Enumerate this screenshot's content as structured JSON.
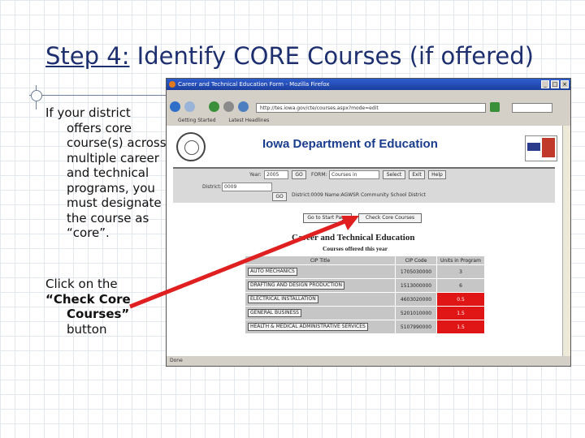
{
  "slide": {
    "title_prefix": "Step 4:",
    "title_rest": " Identify CORE Courses (if offered)",
    "para1": "If your district offers core course(s) across multiple career and technical programs, you must designate the course as “core”.",
    "para2_line1": "Click on the",
    "para2_bold": "“Check Core Courses”",
    "para2_line3": "button"
  },
  "browser": {
    "window_title": "Career and Technical Education Form - Mozilla Firefox",
    "url": "http://tes.iowa.gov/cte/courses.aspx?mode=edit",
    "bookmarks": [
      "Getting Started",
      "Latest Headlines"
    ],
    "status": "Done",
    "window_buttons": [
      "_",
      "□",
      "×"
    ]
  },
  "page": {
    "heading": "Iowa Department of Education",
    "year_label": "Year:",
    "year_value": "2005",
    "go_label": "GO",
    "form_label": "FORM:",
    "form_select": "Courses in Program",
    "select_label": "Select",
    "exit_label": "Exit",
    "help_label": "Help",
    "district_label": "District:",
    "district_value": "0009",
    "go2_label": "GO",
    "district_info": "District:0009  Name:AGWSR Community School District",
    "goto_start_label": "Go to Start Page",
    "check_core_label": "Check Core Courses",
    "cte_title": "Career and Technical Education",
    "cte_sub": "Courses offered this year",
    "table_headers": [
      "CIP Title",
      "CIP Code",
      "Units in Program"
    ],
    "rows": [
      {
        "name": "AUTO MECHANICS",
        "code": "1705030000",
        "units": "3",
        "highlight": false
      },
      {
        "name": "DRAFTING AND DESIGN PRODUCTION",
        "code": "1513000000",
        "units": "6",
        "highlight": false
      },
      {
        "name": "ELECTRICAL INSTALLATION",
        "code": "4603020000",
        "units": "0.5",
        "highlight": true
      },
      {
        "name": "GENERAL BUSINESS",
        "code": "5201010000",
        "units": "1.5",
        "highlight": true
      },
      {
        "name": "HEALTH & MEDICAL ADMINISTRATIVE SERVICES",
        "code": "5107990000",
        "units": "1.5",
        "highlight": true
      }
    ],
    "accent_red": "#e01515",
    "heading_blue": "#1a3c8c"
  }
}
